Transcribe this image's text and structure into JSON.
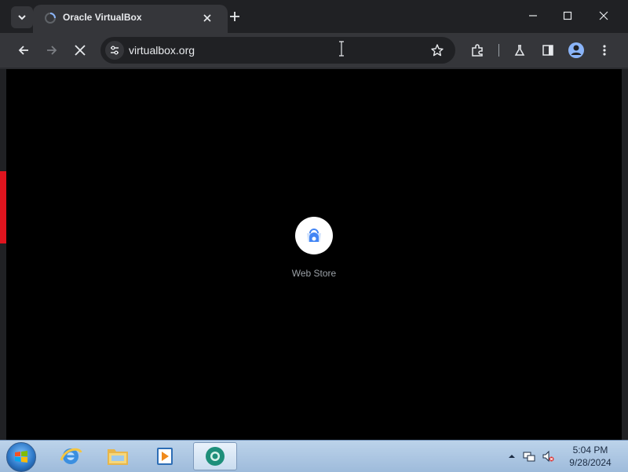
{
  "browser": {
    "tab": {
      "title": "Oracle VirtualBox",
      "favicon": "globe-loading-icon"
    },
    "address": {
      "url": "virtualbox.org"
    },
    "window_controls": [
      "minimize-icon",
      "maximize-icon",
      "close-icon"
    ]
  },
  "content": {
    "shortcut": {
      "label": "Web Store",
      "icon": "web-store-icon"
    }
  },
  "taskbar": {
    "apps": [
      "internet-explorer-icon",
      "file-explorer-icon",
      "media-player-icon",
      "chrome-icon"
    ],
    "clock": {
      "time": "5:04 PM",
      "date": "9/28/2024"
    }
  },
  "colors": {
    "accent": "#e0141e",
    "frame": "#202124",
    "toolbar": "#35363a"
  }
}
